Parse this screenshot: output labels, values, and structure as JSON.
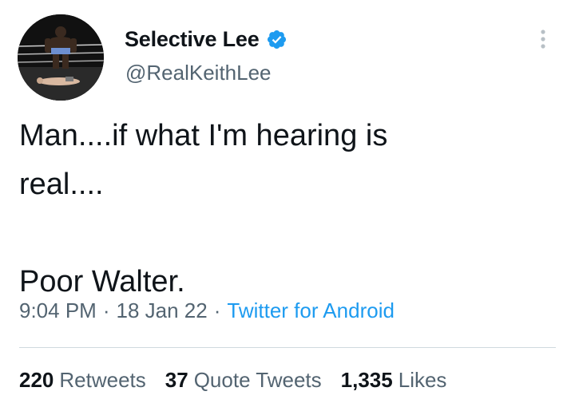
{
  "author": {
    "display_name": "Selective Lee",
    "handle": "@RealKeithLee",
    "verified": true,
    "avatar_icon": "wrestler-photo-avatar",
    "verified_color": "#1d9bf0"
  },
  "tweet": {
    "text": "Man....if what I'm hearing is\nreal....\n\nPoor Walter."
  },
  "meta": {
    "time": "9:04 PM",
    "separator": "·",
    "date": "18 Jan 22",
    "source": "Twitter for Android"
  },
  "stats": {
    "retweets_count": "220",
    "retweets_label": "Retweets",
    "quotes_count": "37",
    "quotes_label": "Quote Tweets",
    "likes_count": "1,335",
    "likes_label": "Likes"
  },
  "colors": {
    "text_primary": "#0f1419",
    "text_secondary": "#536471",
    "link": "#1d9bf0",
    "divider": "#cfd9de"
  }
}
